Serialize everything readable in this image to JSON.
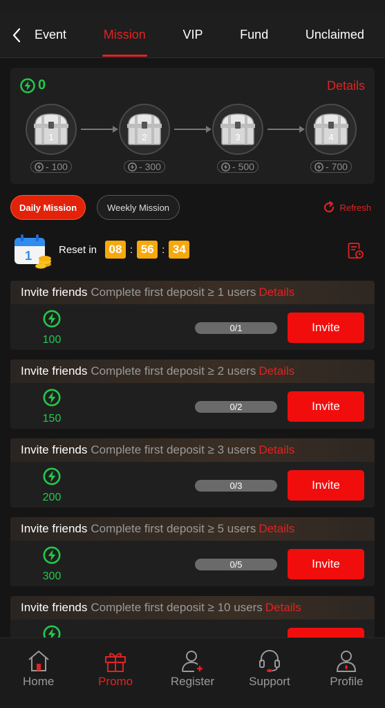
{
  "nav": {
    "tabs": [
      "Event",
      "Mission",
      "VIP",
      "Fund",
      "Unclaimed"
    ],
    "active_tab": "Mission"
  },
  "chest_card": {
    "energy_total": "0",
    "details_label": "Details",
    "chests": [
      {
        "number": "1",
        "cost": "- 100"
      },
      {
        "number": "2",
        "cost": "- 300"
      },
      {
        "number": "3",
        "cost": "- 500"
      },
      {
        "number": "4",
        "cost": "- 700"
      }
    ]
  },
  "mission_tabs": {
    "daily": "Daily Mission",
    "weekly": "Weekly Mission",
    "refresh": "Refresh"
  },
  "reset": {
    "label": "Reset in",
    "hours": "08",
    "minutes": "56",
    "seconds": "34",
    "separator": ":"
  },
  "tasks": [
    {
      "title": "Invite friends",
      "desc": "Complete first deposit ≥ 1 users",
      "details": "Details",
      "reward": "100",
      "progress": "0/1",
      "button": "Invite"
    },
    {
      "title": "Invite friends",
      "desc": "Complete first deposit ≥ 2 users",
      "details": "Details",
      "reward": "150",
      "progress": "0/2",
      "button": "Invite"
    },
    {
      "title": "Invite friends",
      "desc": "Complete first deposit ≥ 3 users",
      "details": "Details",
      "reward": "200",
      "progress": "0/3",
      "button": "Invite"
    },
    {
      "title": "Invite friends",
      "desc": "Complete first deposit ≥ 5 users",
      "details": "Details",
      "reward": "300",
      "progress": "0/5",
      "button": "Invite"
    },
    {
      "title": "Invite friends",
      "desc": "Complete first deposit ≥ 10 users",
      "details": "Details",
      "reward": "",
      "progress": "",
      "button": ""
    }
  ],
  "bottom_nav": [
    {
      "label": "Home",
      "icon": "home-icon"
    },
    {
      "label": "Promo",
      "icon": "gift-icon",
      "active": true
    },
    {
      "label": "Register",
      "icon": "add-user-icon"
    },
    {
      "label": "Support",
      "icon": "headset-icon"
    },
    {
      "label": "Profile",
      "icon": "profile-icon"
    }
  ],
  "colors": {
    "accent": "#e32222",
    "energy": "#22c94a",
    "timer": "#f6a80c",
    "background": "#151515",
    "card": "#1f1f1f"
  }
}
